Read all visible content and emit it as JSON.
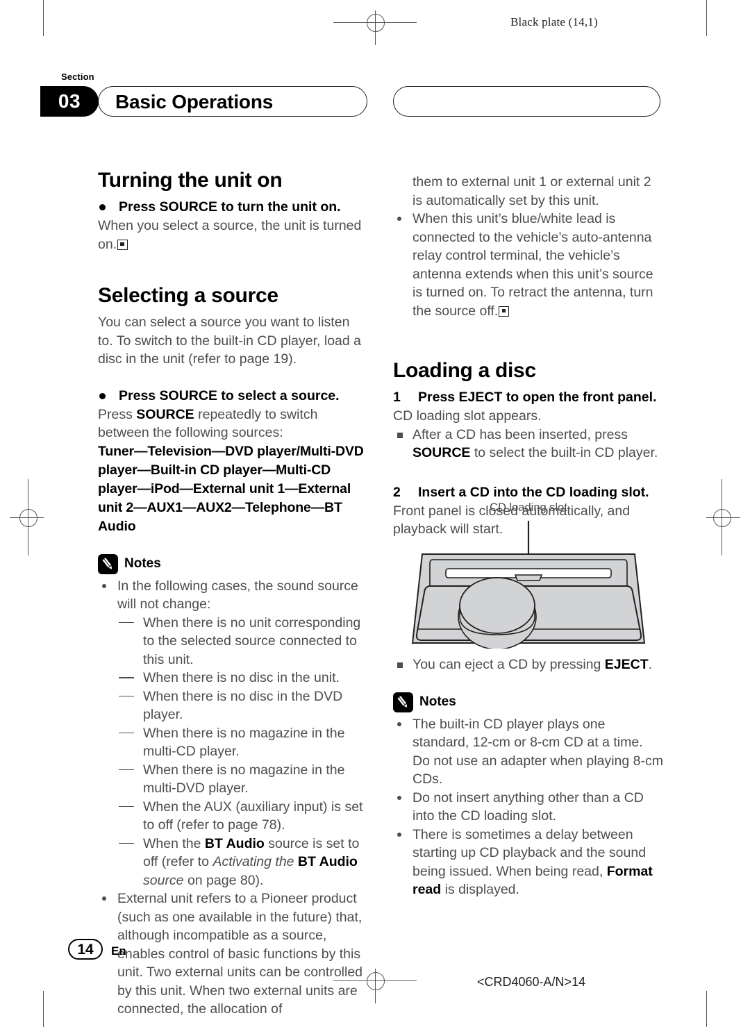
{
  "header": {
    "black_plate": "Black plate (14,1)"
  },
  "section": {
    "kicker": "Section",
    "number": "03",
    "title": "Basic Operations"
  },
  "left_column": {
    "heading_1": "Turning the unit on",
    "bullet_1": "Press SOURCE to turn the unit on.",
    "para_1": "When you select a source, the unit is turned on.",
    "heading_2": "Selecting a source",
    "para_2": "You can select a source you want to listen to. To switch to the built-in CD player, load a disc in the unit (refer to page 19).",
    "bullet_2": "Press SOURCE to select a source.",
    "para_3_pre": "Press ",
    "para_3_bold": "SOURCE",
    "para_3_post": " repeatedly to switch between the following sources:",
    "source_chain": "Tuner—Television—DVD player/Multi-DVD player—Built-in CD player—Multi-CD player—iPod—External unit 1—External unit 2—AUX1—AUX2—Telephone—BT Audio",
    "notes_label": "Notes",
    "note_1": "In the following cases, the sound source will not change:",
    "note_1_sub": [
      "When there is no unit corresponding to the selected source connected to this unit.",
      "When there is no disc in the unit.",
      "When there is no disc in the DVD player.",
      "When there is no magazine in the multi-CD player.",
      "When there is no magazine in the multi-DVD player.",
      "When the AUX (auxiliary input) is set to off (refer to page 78)."
    ],
    "note_1_sub_last": {
      "pre": "When the ",
      "bold1": "BT Audio",
      "mid": " source is set to off (refer to ",
      "italic1": "Activating the ",
      "bold2": "BT Audio",
      "italic2": " source",
      "post": " on page 80)."
    },
    "note_2": "External unit refers to a Pioneer product (such as one available in the future) that, although incompatible as a source, enables control of basic functions by this unit. Two external units can be controlled by this unit. When two external units are connected, the allocation of"
  },
  "right_column": {
    "cont_para": "them to external unit 1 or external unit 2 is automatically set by this unit.",
    "note_antenna": "When this unit’s blue/white lead is connected to the vehicle’s auto-antenna relay control terminal, the vehicle’s antenna extends when this unit’s source is turned on. To retract the antenna, turn the source off.",
    "heading_1": "Loading a disc",
    "step_1_num": "1",
    "step_1": "Press EJECT to open the front panel.",
    "step_1_body": "CD loading slot appears.",
    "step_1_tip_pre": "After a CD has been inserted, press ",
    "step_1_tip_bold": "SOURCE",
    "step_1_tip_post": " to select the built-in CD player.",
    "step_2_num": "2",
    "step_2": "Insert a CD into the CD loading slot.",
    "step_2_body": "Front panel is closed automatically, and playback will start.",
    "illustration_caption": "CD loading slot",
    "tip_eject_pre": "You can eject a CD by pressing ",
    "tip_eject_bold": "EJECT",
    "tip_eject_post": ".",
    "notes_label": "Notes",
    "note_1": "The built-in CD player plays one standard, 12-cm or 8-cm CD at a time. Do not use an adapter when playing 8-cm CDs.",
    "note_2": "Do not insert anything other than a CD into the CD loading slot.",
    "note_3_pre": "There is sometimes a delay between starting up CD playback and the sound being issued. When being read, ",
    "note_3_bold": "Format read",
    "note_3_post": " is displayed."
  },
  "footer": {
    "page_number": "14",
    "language": "En",
    "code": "<CRD4060-A/N>14"
  },
  "colors": {
    "body_text": "#4d4d4f",
    "heading_text": "#000000",
    "illustration_fill": "#d2d3d5",
    "illustration_stroke": "#231f20"
  }
}
